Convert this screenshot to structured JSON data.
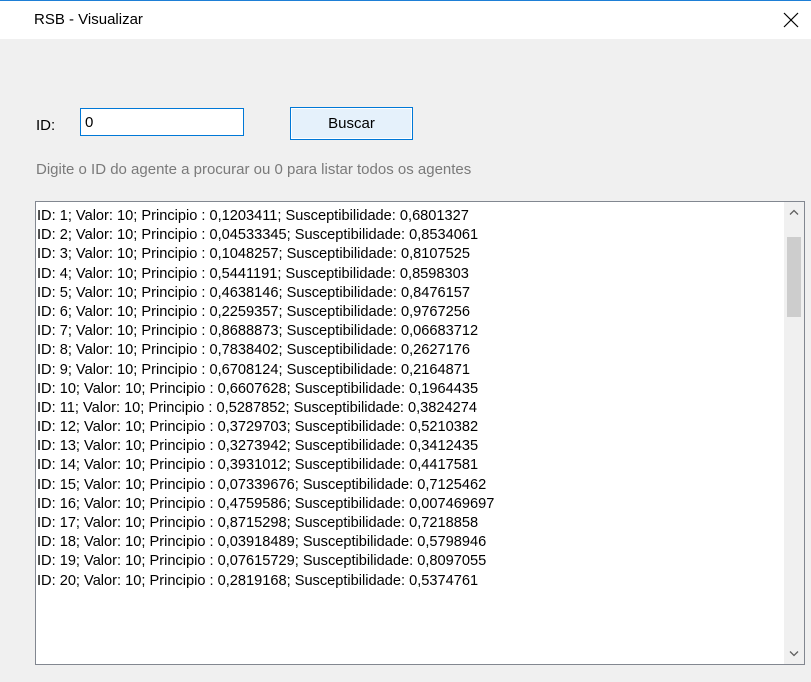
{
  "window": {
    "title": "RSB - Visualizar"
  },
  "form": {
    "id_label": "ID:",
    "id_value": "0",
    "search_label": "Buscar",
    "hint": "Digite o ID do agente a procurar ou 0 para listar todos os agentes"
  },
  "results": [
    "ID: 1; Valor: 10; Principio : 0,1203411; Susceptibilidade: 0,6801327",
    "ID: 2; Valor: 10; Principio : 0,04533345; Susceptibilidade: 0,8534061",
    "ID: 3; Valor: 10; Principio : 0,1048257; Susceptibilidade: 0,8107525",
    "ID: 4; Valor: 10; Principio : 0,5441191; Susceptibilidade: 0,8598303",
    "ID: 5; Valor: 10; Principio : 0,4638146; Susceptibilidade: 0,8476157",
    "ID: 6; Valor: 10; Principio : 0,2259357; Susceptibilidade: 0,9767256",
    "ID: 7; Valor: 10; Principio : 0,8688873; Susceptibilidade: 0,06683712",
    "ID: 8; Valor: 10; Principio : 0,7838402; Susceptibilidade: 0,2627176",
    "ID: 9; Valor: 10; Principio : 0,6708124; Susceptibilidade: 0,2164871",
    "ID: 10; Valor: 10; Principio : 0,6607628; Susceptibilidade: 0,1964435",
    "ID: 11; Valor: 10; Principio : 0,5287852; Susceptibilidade: 0,3824274",
    "ID: 12; Valor: 10; Principio : 0,3729703; Susceptibilidade: 0,5210382",
    "ID: 13; Valor: 10; Principio : 0,3273942; Susceptibilidade: 0,3412435",
    "ID: 14; Valor: 10; Principio : 0,3931012; Susceptibilidade: 0,4417581",
    "ID: 15; Valor: 10; Principio : 0,07339676; Susceptibilidade: 0,7125462",
    "ID: 16; Valor: 10; Principio : 0,4759586; Susceptibilidade: 0,007469697",
    "ID: 17; Valor: 10; Principio : 0,8715298; Susceptibilidade: 0,7218858",
    "ID: 18; Valor: 10; Principio : 0,03918489; Susceptibilidade: 0,5798946",
    "ID: 19; Valor: 10; Principio : 0,07615729; Susceptibilidade: 0,8097055",
    "ID: 20; Valor: 10; Principio : 0,2819168; Susceptibilidade: 0,5374761"
  ],
  "icons": {
    "close": "close-icon",
    "scroll_up": "chevron-up-icon",
    "scroll_down": "chevron-down-icon"
  },
  "colors": {
    "accent": "#0078d7",
    "hint_text": "#7a7a7a",
    "dialog_bg": "#f0f0f0"
  }
}
